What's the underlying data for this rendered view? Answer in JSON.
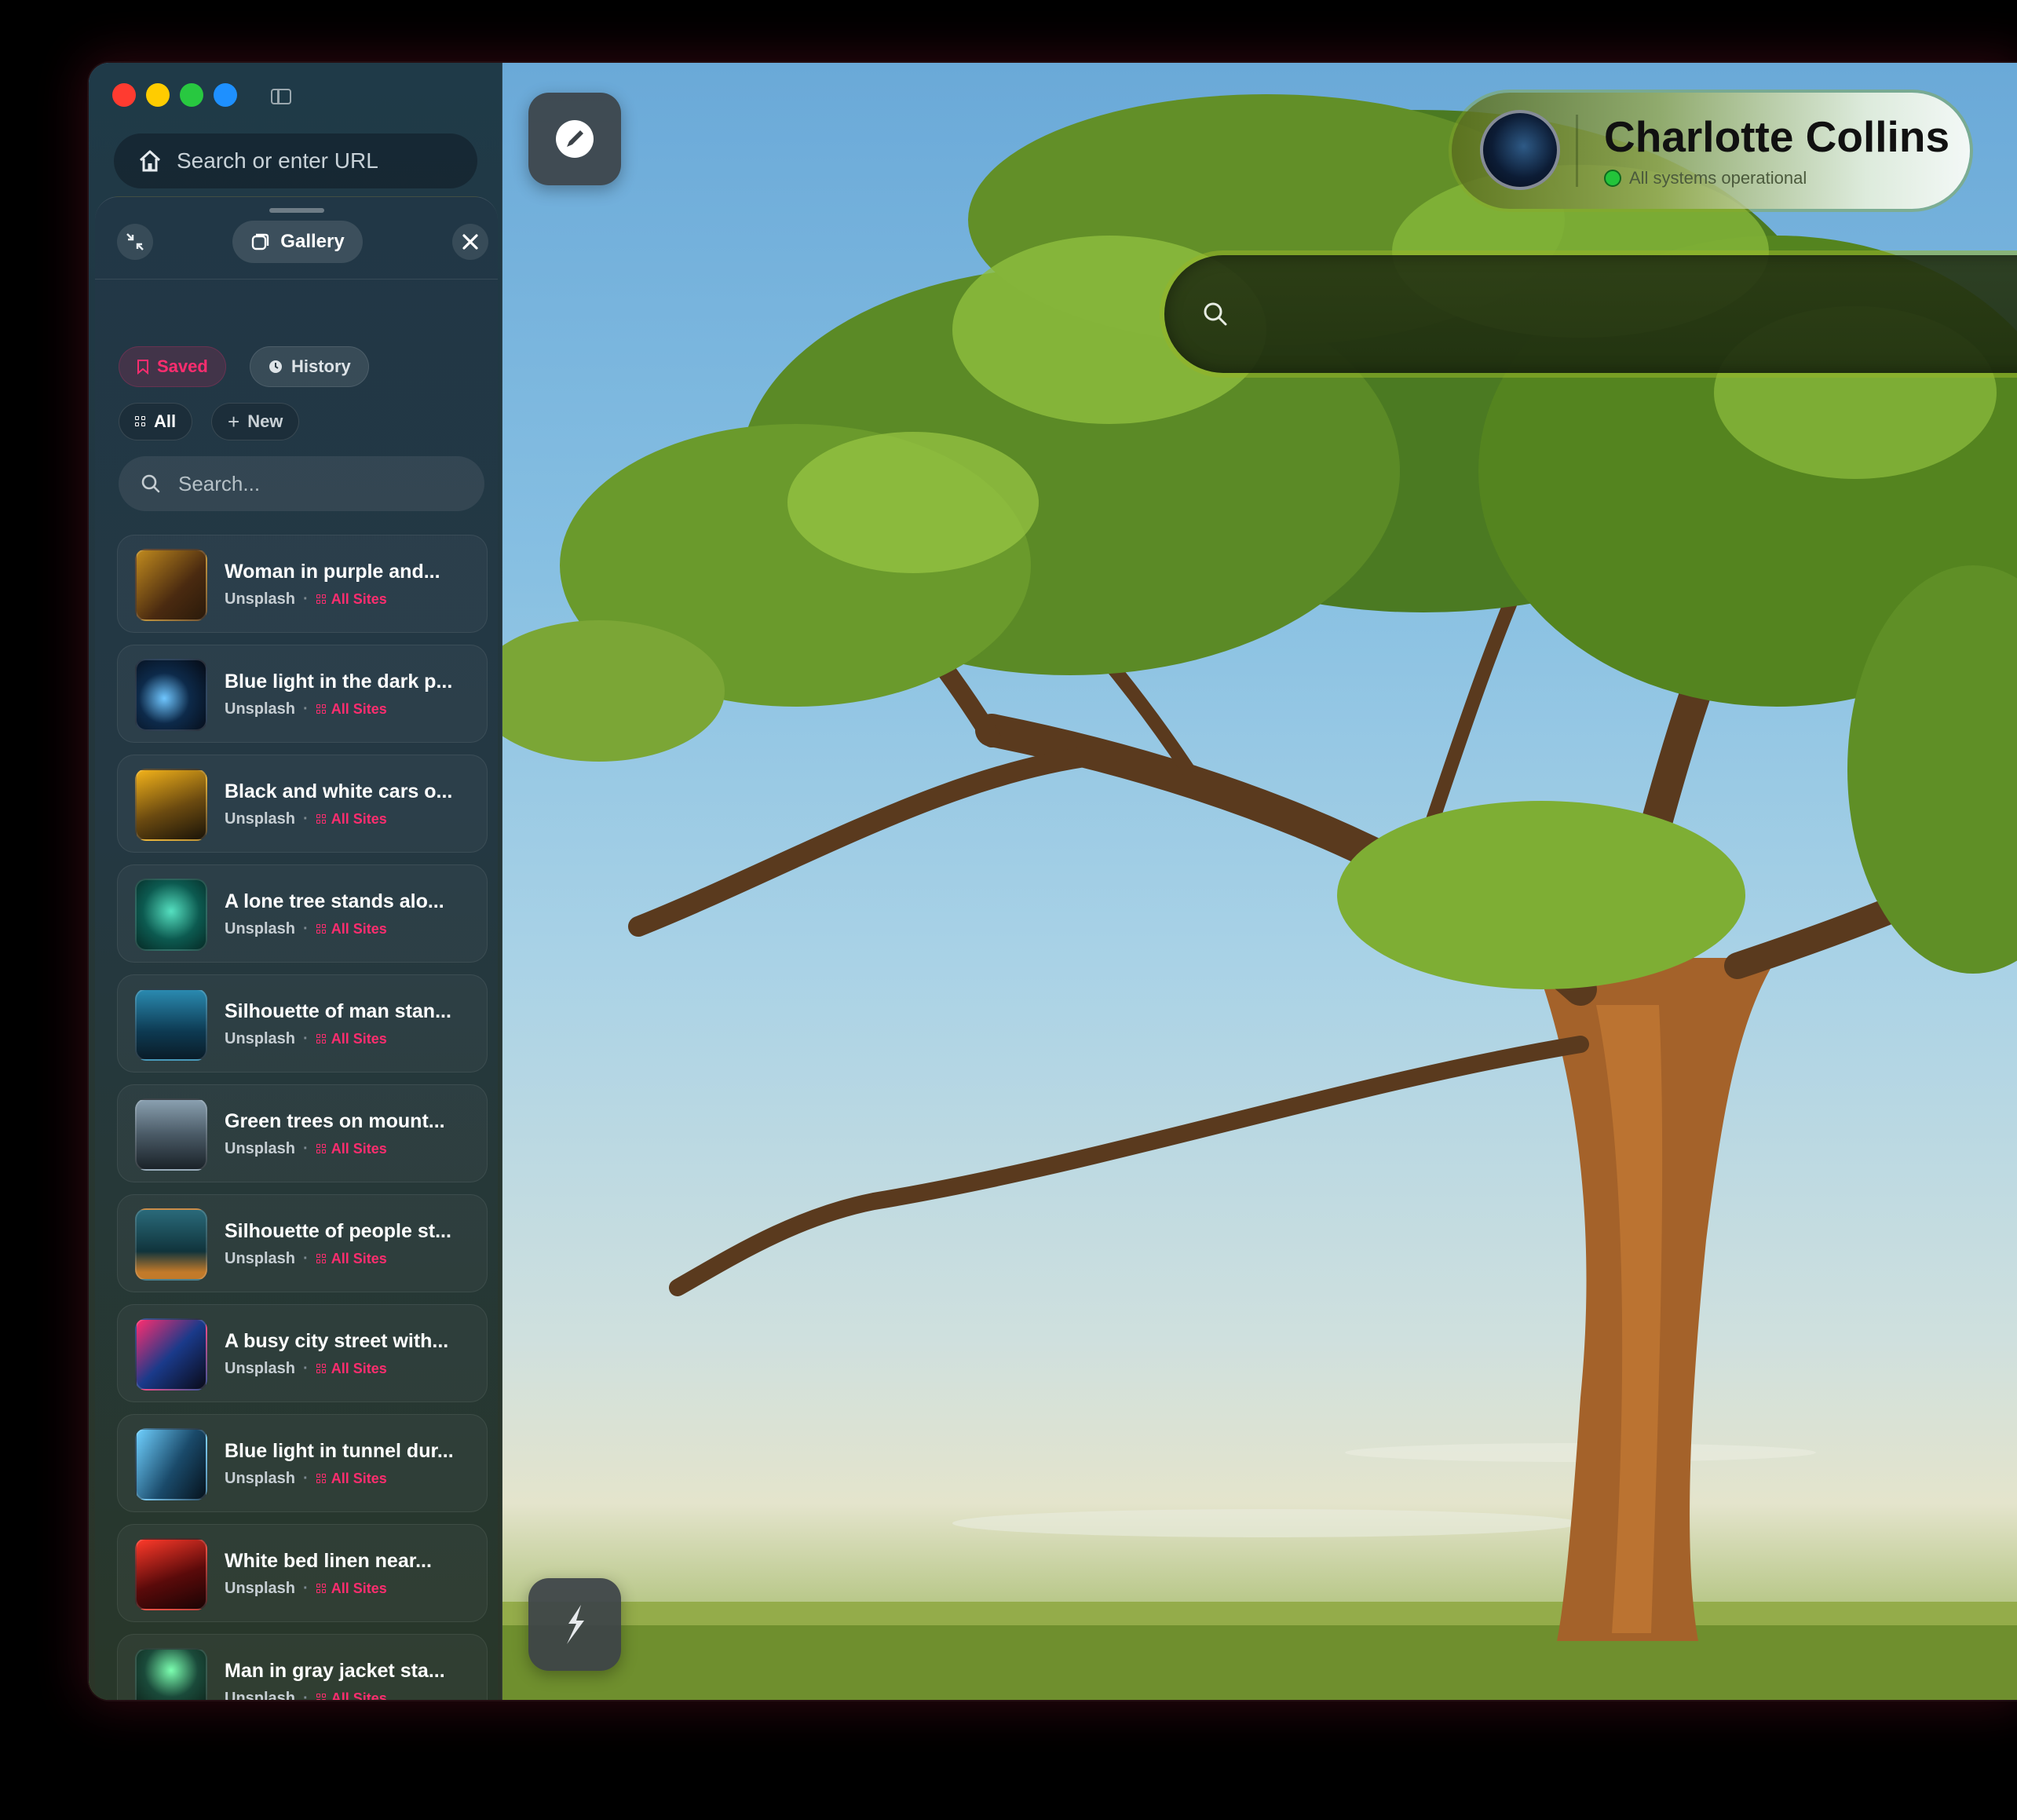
{
  "browser": {
    "traffic_lights": [
      "#ff3b30",
      "#ffcc00",
      "#28c840",
      "#1e90ff"
    ],
    "url_placeholder": "Search or enter URL"
  },
  "panel": {
    "title": "Gallery",
    "tabs": [
      {
        "label": "Saved",
        "active": true
      },
      {
        "label": "History",
        "active": false
      }
    ],
    "filters": [
      {
        "label": "All"
      },
      {
        "label": "New"
      }
    ],
    "search_placeholder": "Search...",
    "items": [
      {
        "title": "Woman in purple and...",
        "source": "Unsplash",
        "tag": "All Sites"
      },
      {
        "title": "Blue light in the dark p...",
        "source": "Unsplash",
        "tag": "All Sites"
      },
      {
        "title": "Black and white cars o...",
        "source": "Unsplash",
        "tag": "All Sites"
      },
      {
        "title": "A lone tree stands alo...",
        "source": "Unsplash",
        "tag": "All Sites"
      },
      {
        "title": "Silhouette of man stan...",
        "source": "Unsplash",
        "tag": "All Sites"
      },
      {
        "title": "Green trees on mount...",
        "source": "Unsplash",
        "tag": "All Sites"
      },
      {
        "title": "Silhouette of people st...",
        "source": "Unsplash",
        "tag": "All Sites"
      },
      {
        "title": "A busy city street with...",
        "source": "Unsplash",
        "tag": "All Sites"
      },
      {
        "title": "Blue light in tunnel dur...",
        "source": "Unsplash",
        "tag": "All Sites"
      },
      {
        "title": "White bed linen near...",
        "source": "Unsplash",
        "tag": "All Sites"
      },
      {
        "title": "Man in gray jacket sta...",
        "source": "Unsplash",
        "tag": "All Sites"
      }
    ]
  },
  "profile": {
    "name": "Charlotte Collins",
    "status": "All systems operational"
  },
  "colors": {
    "accent": "#ff2d6f",
    "status_ok": "#23c43a"
  }
}
